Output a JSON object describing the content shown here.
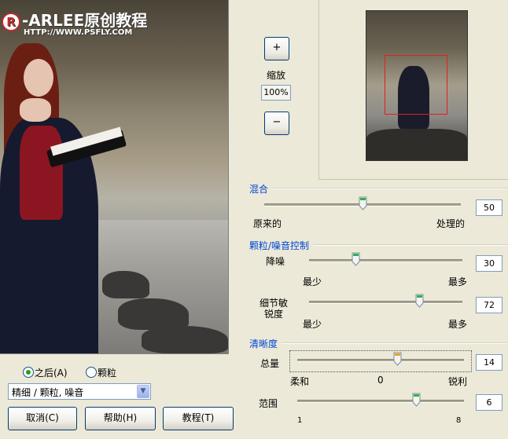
{
  "preview": {
    "logo_text": "-ARLEE原创教程",
    "logo_mark": "R",
    "url_text": "HTTP://WWW.PSFLY.COM"
  },
  "zoom": {
    "plus_label": "+",
    "label": "缩放",
    "value": "100%",
    "minus_label": "−"
  },
  "blend": {
    "title": "混合",
    "left_label": "原来的",
    "right_label": "处理的",
    "value": "50",
    "fraction": 0.5
  },
  "grain": {
    "title": "颗粒/噪音控制",
    "reduce": {
      "label": "降噪",
      "value": "30",
      "fraction": 0.3,
      "min_label": "最少",
      "max_label": "最多"
    },
    "detail": {
      "label_line1": "细节敏",
      "label_line2": "锐度",
      "value": "72",
      "fraction": 0.72,
      "min_label": "最少",
      "max_label": "最多"
    }
  },
  "sharpness": {
    "title": "清晰度",
    "amount": {
      "label": "总量",
      "value": "14",
      "left_label": "柔和",
      "mid_label": "0",
      "right_label": "锐利",
      "fraction": 0.6
    },
    "range": {
      "label": "范围",
      "value": "6",
      "min_label": "1",
      "max_label": "8",
      "fraction": 0.714
    }
  },
  "view_options": {
    "after_label": "之后(A)",
    "after_selected": true,
    "grain_label": "颗粒",
    "grain_selected": false
  },
  "preset": {
    "selected": "精细 / 颗粒, 噪音"
  },
  "buttons": {
    "cancel": "取消(C)",
    "help": "帮助(H)",
    "tutorial": "教程(T)"
  },
  "colors": {
    "group_title": "#0046d5",
    "nav_rect": "#e0201a",
    "thumb_green": "#2fb34a",
    "thumb_orange": "#f0a030"
  }
}
